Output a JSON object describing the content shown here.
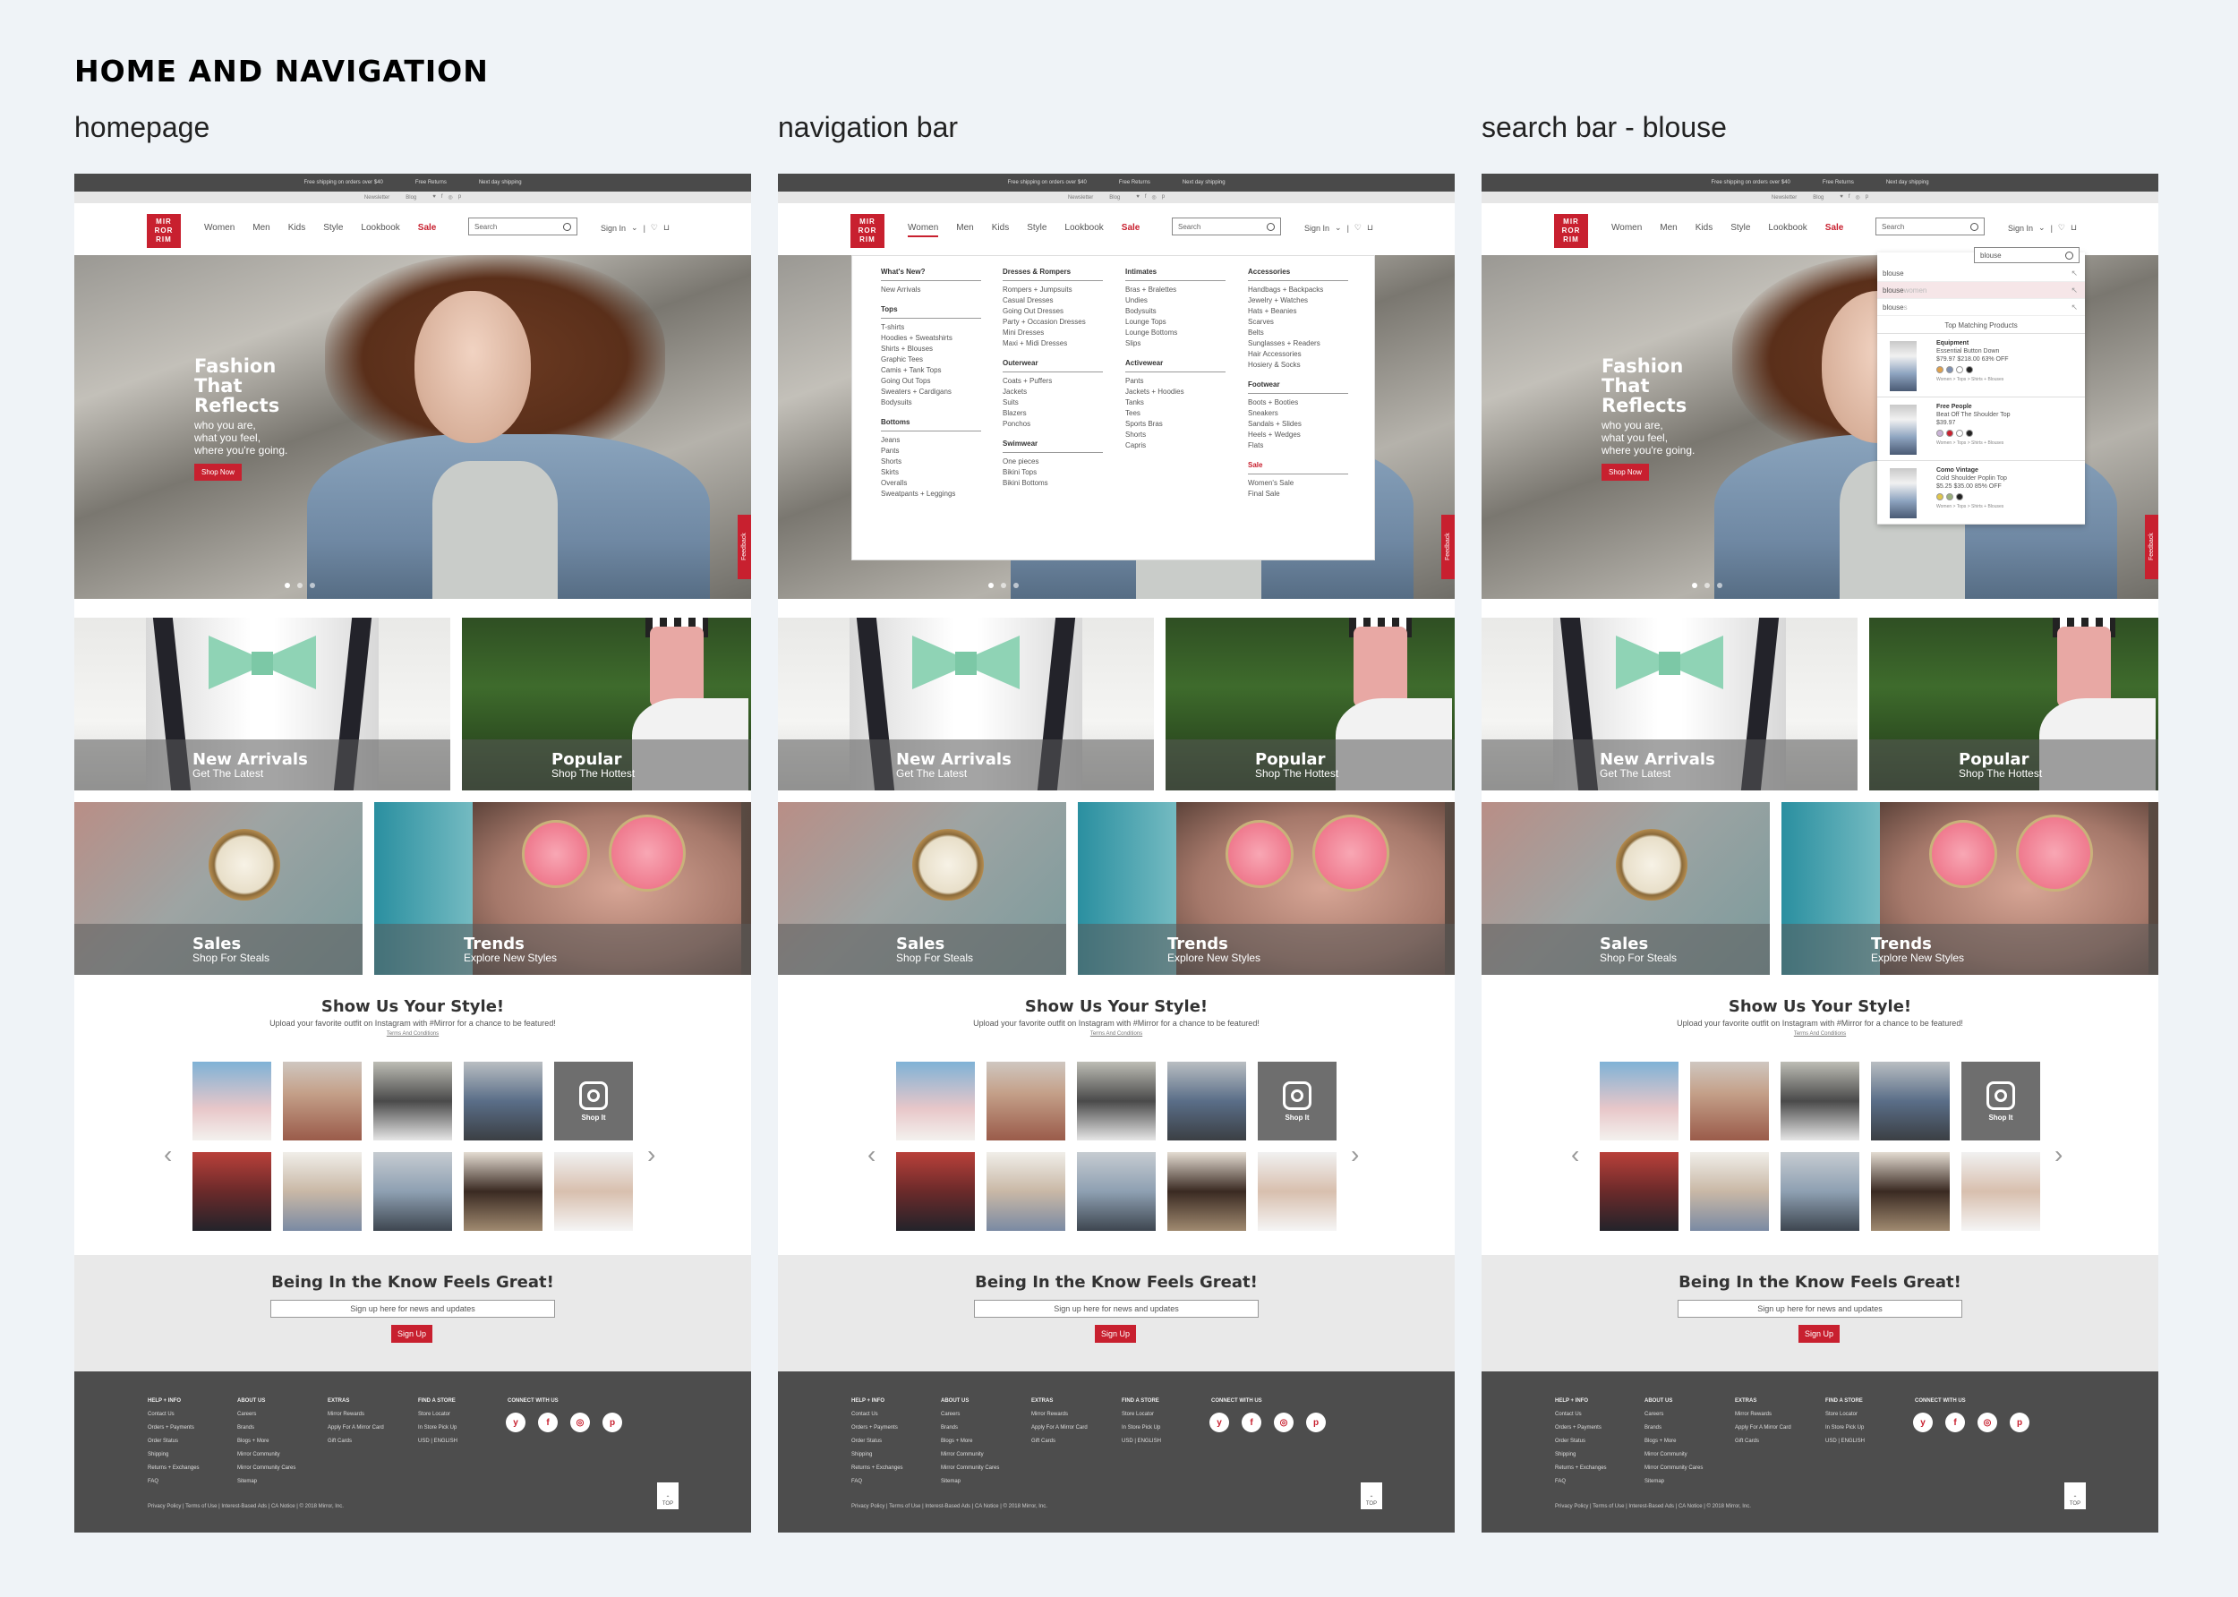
{
  "board": {
    "title": "HOME AND NAVIGATION",
    "columns": [
      "homepage",
      "navigation bar",
      "search bar - blouse"
    ]
  },
  "site": {
    "topbar": [
      "Free shipping on orders over $40",
      "Free Returns",
      "Next day shipping"
    ],
    "subbar": [
      "Newsletter",
      "Blog"
    ],
    "logo": [
      "MIR",
      "ROR",
      "RIM"
    ],
    "nav": [
      "Women",
      "Men",
      "Kids",
      "Style",
      "Lookbook",
      "Sale"
    ],
    "search_placeholder": "Search",
    "sign_in": "Sign In",
    "hero": {
      "headline": [
        "Fashion",
        "That",
        "Reflects"
      ],
      "sub": [
        "who you are,",
        "what you feel,",
        "where you're going."
      ],
      "cta": "Shop Now"
    },
    "feedback": "Feedback",
    "tiles": [
      {
        "title": "New Arrivals",
        "sub": "Get The Latest"
      },
      {
        "title": "Popular",
        "sub": "Shop The Hottest"
      },
      {
        "title": "Sales",
        "sub": "Shop For Steals"
      },
      {
        "title": "Trends",
        "sub": "Explore New Styles"
      }
    ],
    "style_section": {
      "title": "Show Us Your Style!",
      "sub": "Upload your favorite outfit on Instagram with #Mirror for a chance to be featured!",
      "terms": "Terms And Conditions",
      "shop_it": "Shop It"
    },
    "signup": {
      "title": "Being In the Know Feels Great!",
      "placeholder": "Sign up here for news and updates",
      "button": "Sign Up"
    },
    "footer": {
      "cols": [
        {
          "head": "HELP + INFO",
          "items": [
            "Contact Us",
            "Orders + Payments",
            "Order Status",
            "Shipping",
            "Returns + Exchanges",
            "FAQ"
          ]
        },
        {
          "head": "ABOUT US",
          "items": [
            "Careers",
            "Brands",
            "Blogs + More",
            "Mirror Community",
            "Mirror Community Cares",
            "Sitemap"
          ]
        },
        {
          "head": "EXTRAS",
          "items": [
            "Mirror Rewards",
            "Apply For A Mirror Card",
            "Gift Cards"
          ]
        },
        {
          "head": "FIND A STORE",
          "items": [
            "Store Locator",
            "In Store Pick Up",
            "",
            "USD | ENGLISH"
          ]
        },
        {
          "head": "CONNECT WITH US",
          "items": []
        }
      ],
      "social": [
        "y",
        "f",
        "◎",
        "p"
      ],
      "legal": "Privacy Policy | Terms of Use | Interest-Based Ads | CA Notice | © 2018 Mirror, Inc.",
      "top": "TOP"
    }
  },
  "mega_menu": {
    "cols": [
      [
        {
          "head": "What's New?",
          "items": [
            "New Arrivals"
          ]
        },
        {
          "head": "Tops",
          "items": [
            "T-shirts",
            "Hoodies + Sweatshirts",
            "Shirts + Blouses",
            "Graphic Tees",
            "Camis + Tank Tops",
            "Going Out Tops",
            "Sweaters + Cardigans",
            "Bodysuits"
          ]
        },
        {
          "head": "Bottoms",
          "items": [
            "Jeans",
            "Pants",
            "Shorts",
            "Skirts",
            "Overalls",
            "Sweatpants + Leggings"
          ]
        }
      ],
      [
        {
          "head": "Dresses & Rompers",
          "items": [
            "Rompers + Jumpsuits",
            "Casual Dresses",
            "Going Out Dresses",
            "Party + Occasion Dresses",
            "Mini Dresses",
            "Maxi + Midi Dresses"
          ]
        },
        {
          "head": "Outerwear",
          "items": [
            "Coats + Puffers",
            "Jackets",
            "Suits",
            "Blazers",
            "Ponchos"
          ]
        },
        {
          "head": "Swimwear",
          "items": [
            "One pieces",
            "Bikini Tops",
            "Bikini Bottoms"
          ]
        }
      ],
      [
        {
          "head": "Intimates",
          "items": [
            "Bras + Bralettes",
            "Undies",
            "Bodysuits",
            "Lounge Tops",
            "Lounge Bottoms",
            "Slips"
          ]
        },
        {
          "head": "Activewear",
          "items": [
            "Pants",
            "Jackets + Hoodies",
            "Tanks",
            "Tees",
            "Sports Bras",
            "Shorts",
            "Capris"
          ]
        }
      ],
      [
        {
          "head": "Accessories",
          "items": [
            "Handbags + Backpacks",
            "Jewelry + Watches",
            "Hats + Beanies",
            "Scarves",
            "Belts",
            "Sunglasses + Readers",
            "Hair Accessories",
            "Hosiery & Socks"
          ]
        },
        {
          "head": "Footwear",
          "items": [
            "Boots + Booties",
            "Sneakers",
            "Sandals + Slides",
            "Heels + Wedges",
            "Flats"
          ]
        },
        {
          "head": "Sale",
          "items": [
            "Women's Sale",
            "Final Sale"
          ]
        }
      ]
    ]
  },
  "search_dropdown": {
    "query": "blouse",
    "suggestions": [
      {
        "text": "blouse",
        "muted": ""
      },
      {
        "text": "blouse",
        "muted": " women"
      },
      {
        "text": "blouse",
        "muted": "s"
      }
    ],
    "top_matching": "Top Matching Products",
    "products": [
      {
        "brand": "Equipment",
        "name": "Essential Button Down",
        "price": "$79.97 $218.00 63% OFF",
        "cat": "Women > Tops > Shirts + Blouses",
        "swatches": [
          "#e0a04a",
          "#7d8fb0",
          "#ffffff",
          "#222222"
        ]
      },
      {
        "brand": "Free People",
        "name": "Beat Off The Shoulder Top",
        "price": "$39.97",
        "cat": "Women > Tops > Shirts + Blouses",
        "swatches": [
          "#c9b3d6",
          "#c8202f",
          "#ffffff",
          "#222222"
        ]
      },
      {
        "brand": "Como Vintage",
        "name": "Cold Shoulder Poplin Top",
        "price": "$5.25 $35.00 85% OFF",
        "cat": "Women > Tops > Shirts + Blouses",
        "swatches": [
          "#e0c64a",
          "#9ab07d",
          "#222222"
        ]
      }
    ]
  },
  "colors": {
    "brand_red": "#c8202f",
    "footer_gray": "#4d4d4d",
    "board_bg": "#eff3f7"
  }
}
